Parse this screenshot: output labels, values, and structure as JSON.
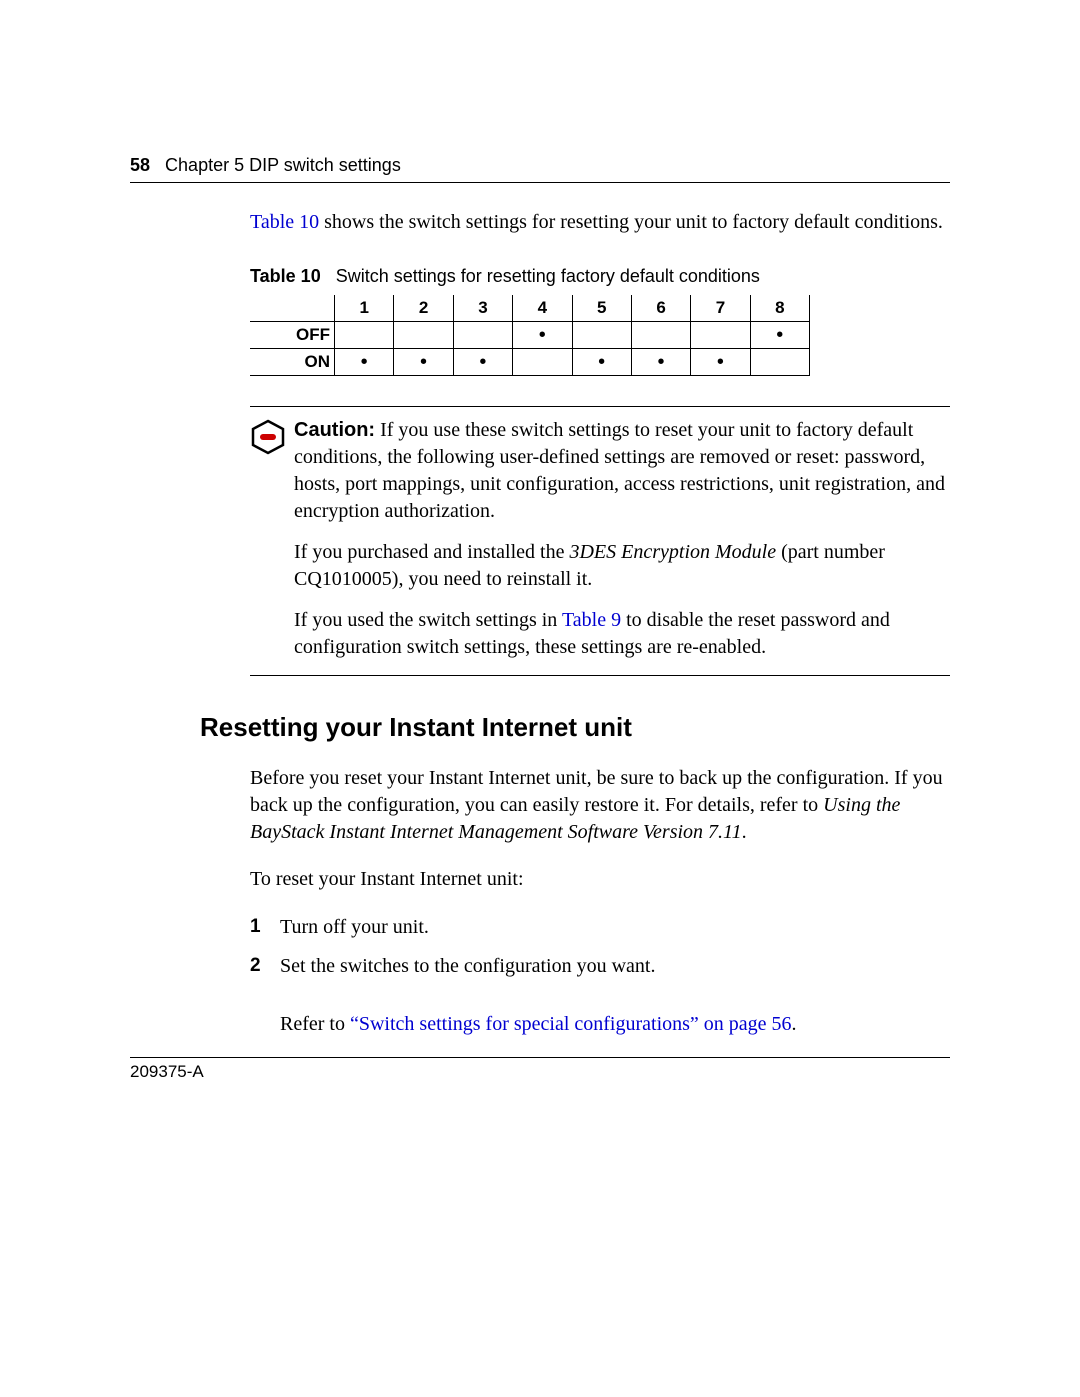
{
  "header": {
    "page_number": "58",
    "chapter_line": "Chapter 5  DIP switch settings"
  },
  "intro": {
    "link_text": "Table 10",
    "after_link": " shows the switch settings for resetting your unit to factory default conditions."
  },
  "table": {
    "label": "Table 10",
    "caption": "Switch settings for resetting factory default conditions",
    "columns": [
      "1",
      "2",
      "3",
      "4",
      "5",
      "6",
      "7",
      "8"
    ],
    "rows": [
      {
        "label": "OFF",
        "cells": [
          "",
          "",
          "",
          "•",
          "",
          "",
          "",
          "•"
        ]
      },
      {
        "label": "ON",
        "cells": [
          "•",
          "•",
          "•",
          "",
          "•",
          "•",
          "•",
          ""
        ]
      }
    ]
  },
  "caution": {
    "heading": "Caution:",
    "p1_rest": " If you use these switch settings to reset your unit to factory default conditions, the following user-defined settings are removed or reset: password, hosts, port mappings, unit configuration, access restrictions, unit registration, and encryption authorization.",
    "p2_before": "If you purchased and installed the ",
    "p2_ital": "3DES Encryption Module",
    "p2_after": " (part number CQ1010005), you need to reinstall it.",
    "p3_before": "If you used the switch settings in ",
    "p3_link": "Table 9",
    "p3_after": " to disable the reset password and configuration switch settings, these settings are re-enabled."
  },
  "section": {
    "heading": "Resetting your Instant Internet unit",
    "p1_plain1": "Before you reset your Instant Internet unit, be sure to back up the configuration. If you back up the configuration, you can easily restore it. For details, refer to ",
    "p1_ital": "Using the BayStack Instant Internet Management Software Version 7.11",
    "p1_plain2": ".",
    "p2": "To reset your Instant Internet unit:",
    "steps": {
      "s1": "Turn off your unit.",
      "s2": "Set the switches to the configuration you want.",
      "s2_sub_before": "Refer to ",
      "s2_sub_link": "“Switch settings for special configurations” on page 56",
      "s2_sub_after": "."
    }
  },
  "footer": {
    "docnum": "209375-A"
  }
}
